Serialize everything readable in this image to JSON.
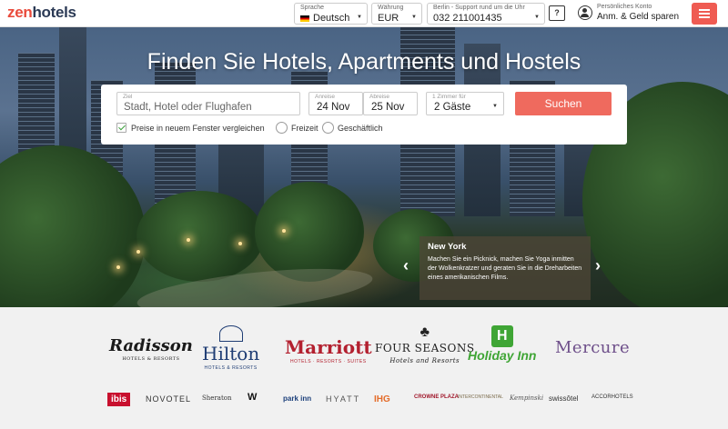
{
  "header": {
    "logo_part1": "zen",
    "logo_part2": "hotels",
    "language": {
      "label": "Sprache",
      "value": "Deutsch"
    },
    "currency": {
      "label": "Währung",
      "value": "EUR"
    },
    "support": {
      "label": "Berlin - Support rund um die Uhr",
      "phone": "032 211001435"
    },
    "chat_icon": "?",
    "account": {
      "label": "Persönliches Konto",
      "value": "Anm. & Geld sparen"
    }
  },
  "hero": {
    "title": "Finden Sie Hotels, Apartments und Hostels",
    "search": {
      "destination_label": "Ziel",
      "destination_placeholder": "Stadt, Hotel oder Flughafen",
      "checkin_label": "Anreise",
      "checkin_value": "24 Nov",
      "checkout_label": "Abreise",
      "checkout_value": "25 Nov",
      "guests_label": "1 Zimmer für",
      "guests_value": "2 Gäste",
      "submit": "Suchen",
      "compare_label": "Preise in neuem Fenster vergleichen",
      "leisure_label": "Freizeit",
      "business_label": "Geschäftlich"
    },
    "promo": {
      "title": "New York",
      "text": "Machen Sie ein Picknick, machen Sie Yoga inmitten der Wolkenkratzer und geraten Sie in die Dreharbeiten eines amerikanischen Films."
    }
  },
  "partners": {
    "large": [
      {
        "name": "Radisson",
        "sub": "HOTELS & RESORTS"
      },
      {
        "name": "Hilton",
        "sub": "HOTELS & RESORTS"
      },
      {
        "name": "Marriott",
        "sub": "HOTELS · RESORTS · SUITES"
      },
      {
        "name": "FOUR SEASONS",
        "sub": "Hotels and Resorts"
      },
      {
        "name": "Holiday Inn",
        "sub": ""
      },
      {
        "name": "Mercure",
        "sub": ""
      }
    ],
    "small": [
      "ibis",
      "NOVOTEL",
      "Sheraton",
      "W",
      "park inn",
      "HYATT",
      "IHG",
      "CROWNE PLAZA",
      "INTERCONTINENTAL",
      "Kempinski",
      "swissôtel",
      "ACCORHOTELS"
    ]
  },
  "colors": {
    "accent": "#ef6a5e",
    "logo_red": "#e94b3c",
    "logo_navy": "#2b3a55"
  }
}
